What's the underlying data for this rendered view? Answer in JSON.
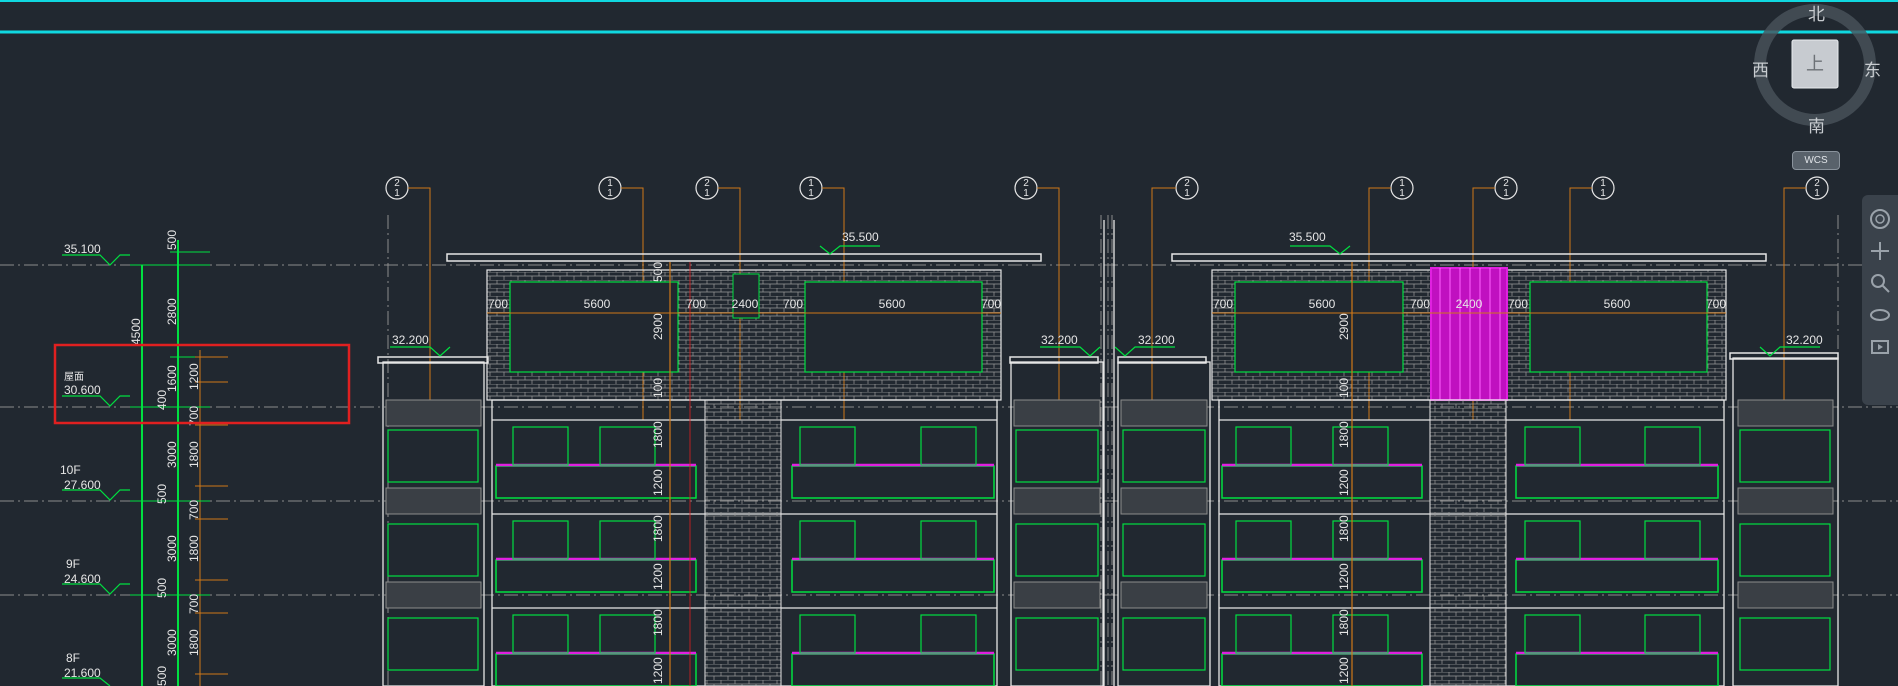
{
  "viewcube": {
    "north": "北",
    "south": "南",
    "east": "东",
    "west": "西",
    "face_label": "上",
    "wcs": "WCS"
  },
  "levels": [
    {
      "name": "",
      "elev": "35.100"
    },
    {
      "name": "屋面",
      "elev": "30.600"
    },
    {
      "name": "10F",
      "elev": "27.600"
    },
    {
      "name": "9F",
      "elev": "24.600"
    },
    {
      "name": "8F",
      "elev": "21.600"
    }
  ],
  "dims_left_outer": [
    "500",
    "2800",
    "4500",
    "1600",
    "400",
    "3000",
    "500",
    "3000",
    "500",
    "3000",
    "500"
  ],
  "dims_left_inner": [
    "1200",
    "700",
    "1800",
    "700",
    "1800",
    "700",
    "1800"
  ],
  "roof_elevations": [
    "35.500",
    "35.500",
    "32.200",
    "32.200",
    "32.200",
    "32.200"
  ],
  "window_dims": [
    "700",
    "5600",
    "700",
    "2400",
    "700",
    "5600",
    "700",
    "700",
    "5600",
    "700",
    "2400",
    "700",
    "5600",
    "700"
  ],
  "vertical_dims": [
    "500",
    "2900",
    "100",
    "1800",
    "1200",
    "1800",
    "1200",
    "1800",
    "1200"
  ],
  "vertical_dims_right": [
    "2900",
    "100",
    "1800",
    "1200",
    "1800",
    "1200",
    "1800",
    "1200"
  ],
  "tags": [
    "2",
    "1",
    "2",
    "1",
    "2",
    "2",
    "1",
    "2",
    "1",
    "2"
  ],
  "tag_sub": "1",
  "colors": {
    "background": "#212830",
    "accent_cyan": "#10d8e0",
    "green": "#00e040",
    "magenta": "#e020e0",
    "red_highlight": "#e02020",
    "orange": "#d07818",
    "white": "#e6e6e6",
    "gray": "#8c8c8c"
  },
  "icons": [
    "viewcube-icon",
    "wheel-icon",
    "pan-icon",
    "zoom-icon",
    "orbit-icon",
    "showmotion-icon"
  ]
}
